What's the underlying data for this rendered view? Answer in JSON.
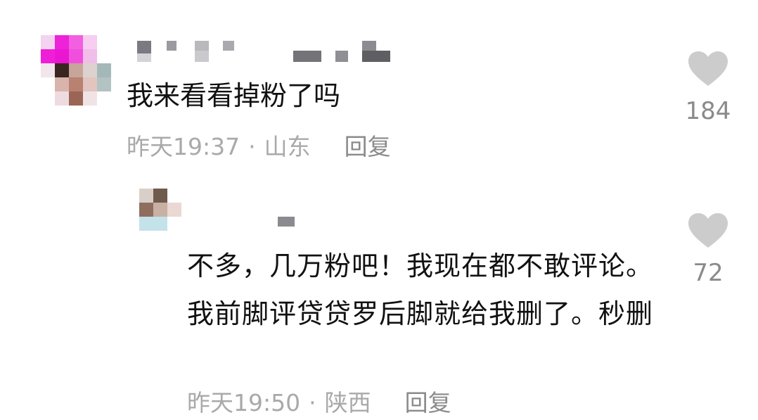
{
  "comments": [
    {
      "text": "我来看看掉粉了吗",
      "time": "昨天19:37",
      "location": "山东",
      "reply_label": "回复",
      "likes": "184"
    },
    {
      "text": "不多，几万粉吧！我现在都不敢评论。我前脚评贷贷罗后脚就给我删了。秒删",
      "time": "昨天19:50",
      "location": "陕西",
      "reply_label": "回复",
      "likes": "72"
    }
  ],
  "separator": "·",
  "colors": {
    "text": "#111111",
    "meta": "#a9a9a9",
    "icon": "#cccccc"
  },
  "icons": {
    "like": "heart-icon"
  }
}
